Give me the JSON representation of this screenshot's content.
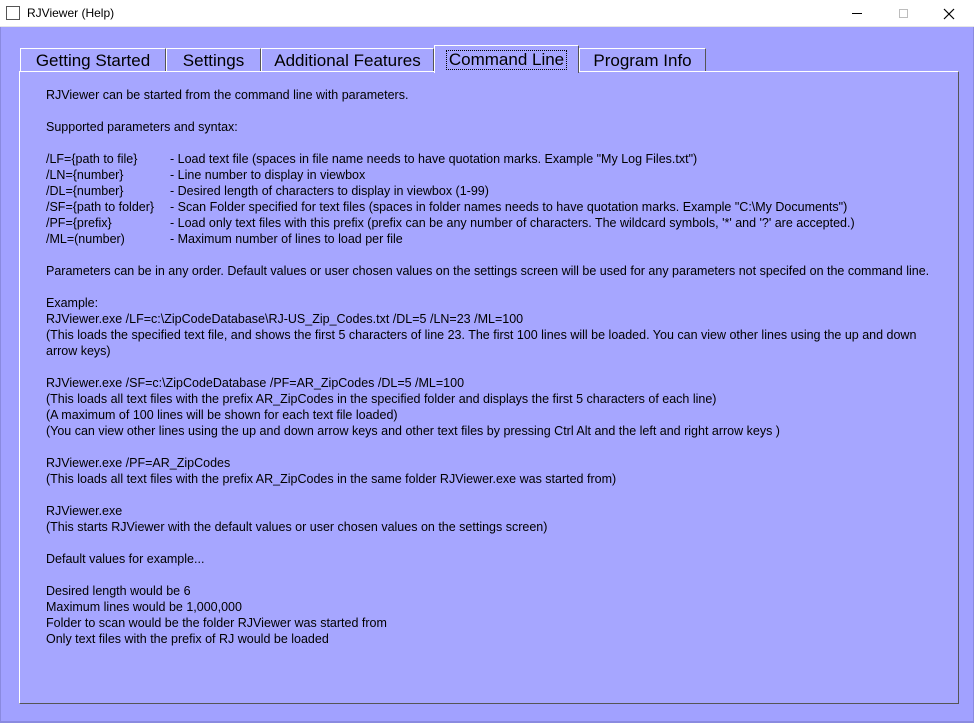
{
  "window": {
    "title": "RJViewer (Help)"
  },
  "tabs": [
    {
      "label": "Getting Started"
    },
    {
      "label": "Settings"
    },
    {
      "label": "Additional Features"
    },
    {
      "label": "Command Line"
    },
    {
      "label": "Program Info"
    }
  ],
  "help": {
    "intro": "RJViewer can be started from the command line with parameters.",
    "supported": "Supported parameters and syntax:",
    "params": [
      {
        "flag": "/LF={path to file}",
        "desc": "- Load text file (spaces in file name needs to have quotation marks. Example \"My Log Files.txt\")"
      },
      {
        "flag": "/LN={number}",
        "desc": "- Line number to display in viewbox"
      },
      {
        "flag": "/DL={number}",
        "desc": "- Desired length of characters to display in viewbox (1-99)"
      },
      {
        "flag": "/SF={path to folder}",
        "desc": "- Scan Folder specified for text files (spaces in folder names needs to have quotation marks. Example \"C:\\My Documents\")"
      },
      {
        "flag": "/PF={prefix}",
        "desc": "- Load only text files with this prefix (prefix can be any number of characters. The wildcard symbols, '*' and '?' are accepted.)"
      },
      {
        "flag": "/ML=(number)",
        "desc": "- Maximum number of lines to load per file"
      }
    ],
    "order_note": "Parameters can be in any order. Default values or user chosen values on the settings screen will be used for any parameters not specifed on the command line.",
    "example_heading": "Example:",
    "example1_cmd": "RJViewer.exe /LF=c:\\ZipCodeDatabase\\RJ-US_Zip_Codes.txt /DL=5 /LN=23 /ML=100",
    "example1_desc": "(This loads the specified text file, and shows the first 5 characters of line 23. The first 100 lines will be loaded. You can view other lines using the up and down arrow keys)",
    "example2_cmd": "RJViewer.exe /SF=c:\\ZipCodeDatabase /PF=AR_ZipCodes /DL=5 /ML=100",
    "example2_desc1": "(This loads all text files with the prefix AR_ZipCodes in the specified folder and displays the first 5 characters of each line)",
    "example2_desc2": "(A maximum of 100 lines will be shown for each text file loaded)",
    "example2_desc3": "(You can view other lines using the up and down arrow keys and other text files by pressing Ctrl Alt and the left and right arrow keys )",
    "example3_cmd": "RJViewer.exe /PF=AR_ZipCodes",
    "example3_desc": "(This loads all text files with the prefix AR_ZipCodes in the same folder RJViewer.exe was started from)",
    "example4_cmd": "RJViewer.exe",
    "example4_desc": "(This starts RJViewer with the default values or user chosen values on the settings screen)",
    "defaults_heading": "Default values for example...",
    "default1": "Desired length would be 6",
    "default2": "Maximum lines would be 1,000,000",
    "default3": "Folder to scan would be the folder RJViewer was started from",
    "default4": "Only text files with the prefix of RJ would be loaded"
  },
  "colors": {
    "client_bg": "#a1a1ff",
    "panel_bg": "#a6a6ff"
  }
}
